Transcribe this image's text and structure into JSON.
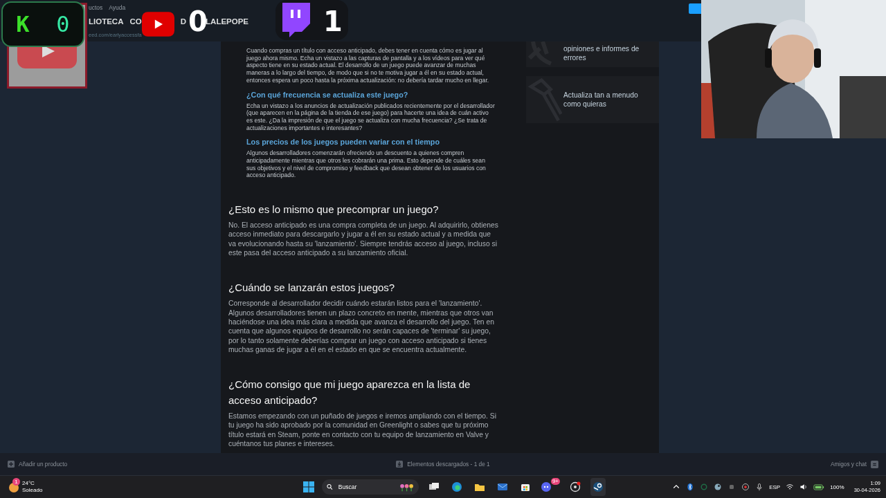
{
  "header": {
    "menu": [
      "uctos",
      "Ayuda"
    ],
    "nav": [
      "LIOTECA",
      "CO",
      "D",
      "LALEPOPE"
    ],
    "url": "eed.com/earlyaccessfa"
  },
  "overlay": {
    "kick": {
      "logo": "K",
      "count": "0"
    },
    "youtube": {
      "count": "0"
    },
    "twitch": {
      "count": "1"
    }
  },
  "article": {
    "nested": [
      {
        "kind": "paragraph",
        "text": "Cuando compras un título con acceso anticipado, debes tener en cuenta cómo es jugar al juego ahora mismo. Echa un vistazo a las capturas de pantalla y a los vídeos para ver qué aspecto tiene en su estado actual. El desarrollo de un juego puede avanzar de muchas maneras a lo largo del tiempo, de modo que si no te motiva jugar a él en su estado actual, entonces espera un poco hasta la próxima actualización: no debería tardar mucho en llegar."
      },
      {
        "kind": "heading",
        "text": "¿Con qué frecuencia se actualiza este juego?"
      },
      {
        "kind": "paragraph",
        "text": "Echa un vistazo a los anuncios de actualización publicados recientemente por el desarrollador (que aparecen en la página de la tienda de ese juego) para hacerte una idea de cuán activo es este. ¿Da la impresión de que el juego se actualiza con mucha frecuencia? ¿Se trata de actualizaciones importantes e interesantes?"
      },
      {
        "kind": "heading",
        "text": "Los precios de los juegos pueden variar con el tiempo"
      },
      {
        "kind": "paragraph",
        "text": "Algunos desarrolladores comenzarán ofreciendo un descuento a quienes compren anticipadamente mientras que otros les cobrarán una prima. Esto depende de cuáles sean sus objetivos y el nivel de compromiso y feedback que desean obtener de los usuarios con acceso anticipado."
      }
    ],
    "sections": [
      {
        "heading": "¿Esto es lo mismo que precomprar un juego?",
        "body": "No. El acceso anticipado es una compra completa de un juego. Al adquirirlo, obtienes acceso inmediato para descargarlo y jugar a él en su estado actual y a medida que va evolucionando hasta su 'lanzamiento'. Siempre tendrás acceso al juego, incluso si este pasa del acceso anticipado a su lanzamiento oficial."
      },
      {
        "heading": "¿Cuándo se lanzarán estos juegos?",
        "body": "Corresponde al desarrollador decidir cuándo estarán listos para el 'lanzamiento'. Algunos desarrolladores tienen un plazo concreto en mente, mientras que otros van haciéndose una idea más clara a medida que avanza el desarrollo del juego. Ten en cuenta que algunos equipos de desarrollo no serán capaces de 'terminar' su juego, por lo tanto solamente deberías comprar un juego con acceso anticipado si tienes muchas ganas de jugar a él en el estado en que se encuentra actualmente."
      },
      {
        "heading": "¿Cómo consigo que mi juego aparezca en la lista de acceso anticipado?",
        "body": "Estamos empezando con un puñado de juegos e iremos ampliando con el tiempo. Si tu juego ha sido aprobado por la comunidad en Greenlight o sabes que tu próximo título estará en Steam, ponte en contacto con tu equipo de lanzamiento en Valve y cuéntanos tus planes e intereses."
      }
    ]
  },
  "features": [
    {
      "text": "opiniones e informes de errores"
    },
    {
      "text": "Actualiza tan a menudo como quieras"
    }
  ],
  "status_bar": {
    "add": "Añadir un producto",
    "downloads": "Elementos descargados - 1 de 1",
    "friends": "Amigos y chat"
  },
  "taskbar": {
    "weather": {
      "badge": "1",
      "temp": "24°C",
      "condition": "Soleado"
    },
    "search": {
      "placeholder": "Buscar"
    },
    "discord_badge": "9+",
    "language": "ESP",
    "battery": "100%",
    "time": "1:09",
    "date": "30-04-2026"
  }
}
